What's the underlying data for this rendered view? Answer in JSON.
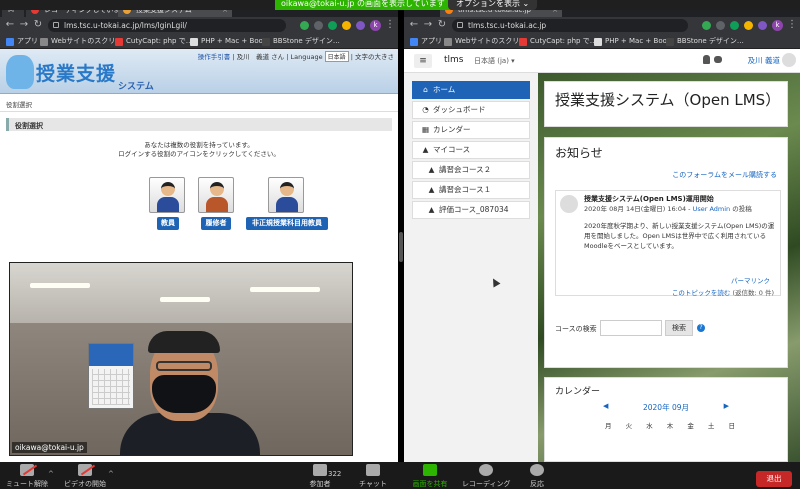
{
  "share": {
    "banner_text": "oikawa@tokai-u.jp の画面を表示しています",
    "options_label": "オプションを表示 ⌄"
  },
  "left_browser": {
    "tabs": [
      {
        "label": "M"
      },
      {
        "label": "レコーディングしています"
      },
      {
        "label": "授業支援システム"
      }
    ],
    "url": "lms.tsc.u-tokai.ac.jp/lms/lginLgil/",
    "bookmarks": [
      "アプリ",
      "Webサイトのスクリ…",
      "CutyCapt: php で…",
      "PHP + Mac + Boo…",
      "BBStone デザイン…"
    ]
  },
  "right_browser": {
    "tab_label": "tlms.tsc.u-tokai.ac.jp",
    "url": "tlms.tsc.u-tokai.ac.jp",
    "bookmarks": [
      "アプリ",
      "Webサイトのスクリ…",
      "CutyCapt: php で…",
      "PHP + Mac + Boo…",
      "BBStone デザイン…"
    ]
  },
  "lms": {
    "logo_title": "授業支援",
    "logo_subtitle": "システム",
    "top_links": {
      "manual": "操作手引書",
      "user": "及川　義道 さん",
      "language_label": "Language",
      "language_value": "日本語",
      "text_size": "文字の大きさ"
    },
    "breadcrumb": "役割選択",
    "section_title": "役割選択",
    "message_line1": "あなたは複数の役割を持っています。",
    "message_line2": "ログインする役割のアイコンをクリックしてください。",
    "roles": [
      {
        "label": "教員"
      },
      {
        "label": "履修者"
      },
      {
        "label": "非正規授業科目用教員"
      }
    ]
  },
  "video": {
    "participant_name": "oikawa@tokai-u.jp"
  },
  "moodle": {
    "site_name": "tlms",
    "language": "日本語 (ja) ▾",
    "user_name": "及川 義道",
    "nav": [
      {
        "label": "ホーム",
        "icon": "home-icon",
        "active": true
      },
      {
        "label": "ダッシュボード",
        "icon": "dashboard-icon",
        "active": false
      },
      {
        "label": "カレンダー",
        "icon": "calendar-icon",
        "active": false
      },
      {
        "label": "マイコース",
        "icon": "graduation-cap-icon",
        "active": false
      },
      {
        "label": "講習会コース２",
        "icon": "graduation-cap-icon",
        "active": false
      },
      {
        "label": "講習会コース１",
        "icon": "graduation-cap-icon",
        "active": false
      },
      {
        "label": "評価コース_087034",
        "icon": "graduation-cap-icon",
        "active": false
      }
    ],
    "page_title": "授業支援システム（Open LMS）",
    "news_title": "お知らせ",
    "subscribe_link": "このフォーラムをメール購読する",
    "post": {
      "subject": "授業支援システム(Open LMS)運用開始",
      "meta_date": "2020年 08月 14日(金曜日) 16:04 - ",
      "meta_user": "User Admin",
      "meta_suffix": " の投稿",
      "body": "2020年度秋学期より、新しい授業支援システム(Open LMS)の運用を開始しました。Open LMSは世界中で広く利用されているMoodleをベースとしています。",
      "permalink": "パーマリンク",
      "read_topic": "このトピックを読む",
      "replies": "(返信数: 0 件)"
    },
    "course_search_label": "コースの検索",
    "search_button": "検索",
    "calendar": {
      "title": "カレンダー",
      "month": "2020年 09月",
      "prev": "◀",
      "next": "▶",
      "weekdays": [
        "月",
        "火",
        "水",
        "木",
        "金",
        "土",
        "日"
      ]
    }
  },
  "zoom_bar": {
    "mute_label": "ミュート解除",
    "video_label": "ビデオの開始",
    "participants_label": "参加者",
    "participants_count": "322",
    "chat_label": "チャット",
    "share_label": "画面を共有",
    "record_label": "レコーディング",
    "reactions_label": "反応",
    "end_label": "退出"
  },
  "colors": {
    "accent_blue": "#1e63b5",
    "share_green": "#2db400",
    "end_red": "#c62828"
  }
}
